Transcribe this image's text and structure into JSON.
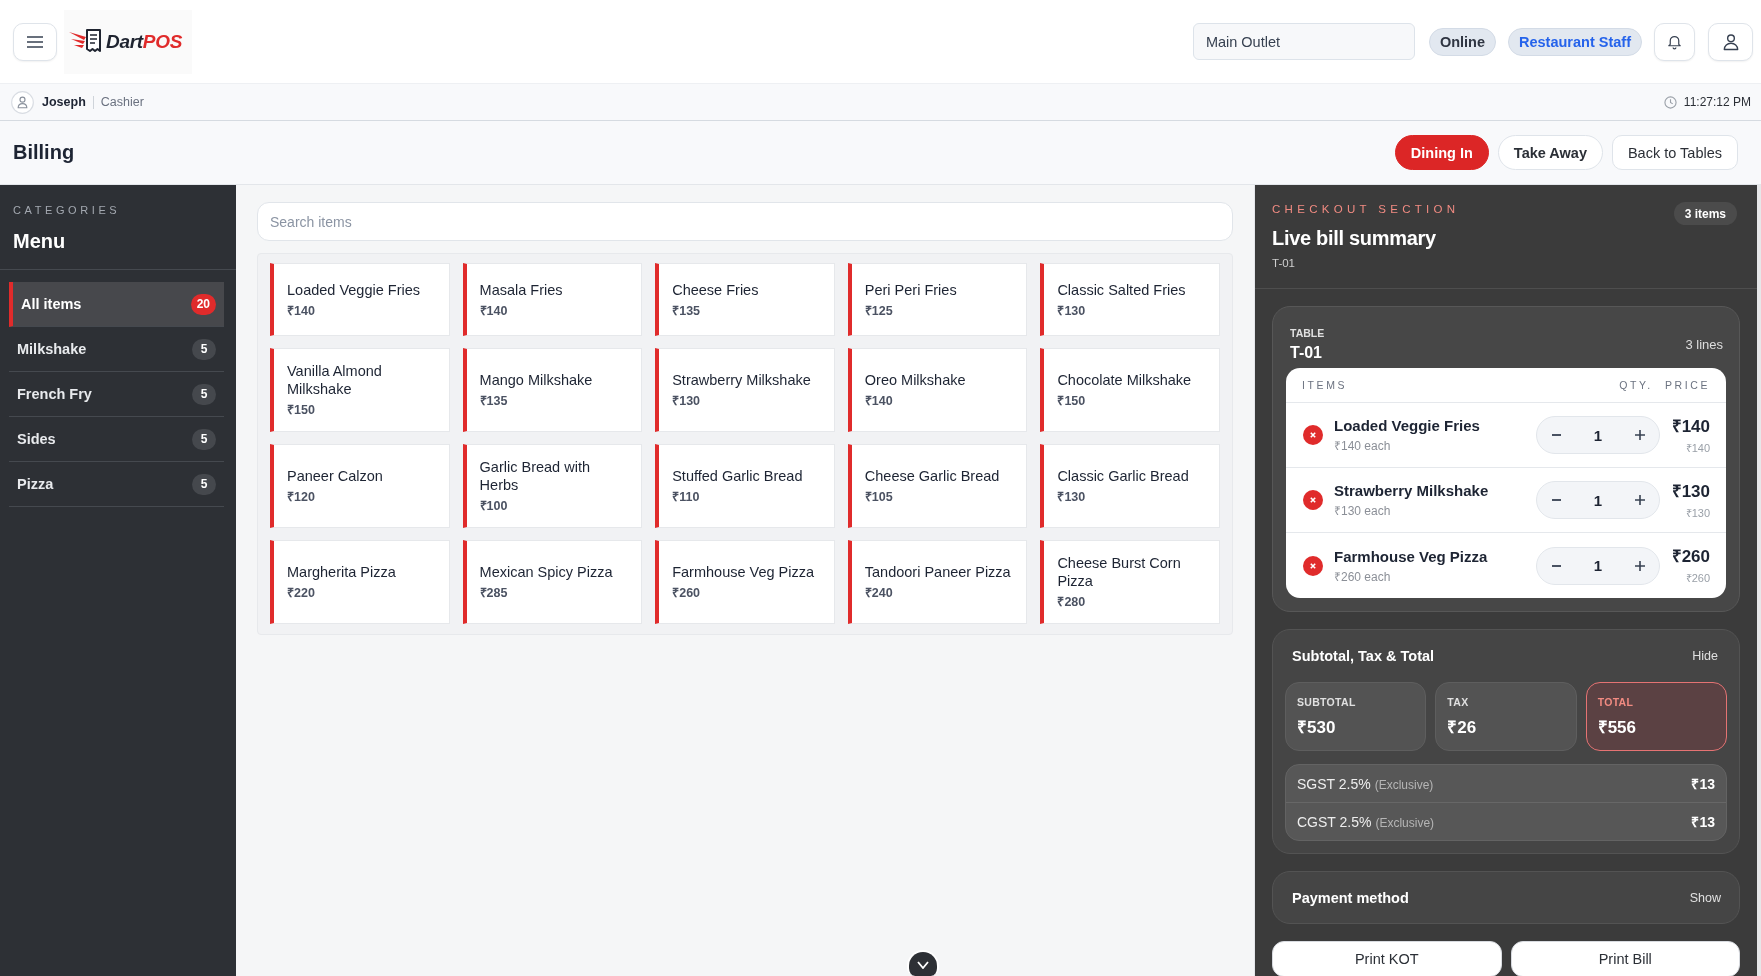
{
  "header": {
    "logo": {
      "brand": "Dart",
      "accent": "POS"
    },
    "outlet": {
      "value": "Main Outlet"
    },
    "status": "Online",
    "role": "Restaurant Staff"
  },
  "user_bar": {
    "name": "Joseph",
    "role": "Cashier",
    "time": "11:27:12 PM"
  },
  "page": {
    "title": "Billing",
    "order_types": [
      {
        "label": "Dining In",
        "selected": true
      },
      {
        "label": "Take Away",
        "selected": false
      }
    ],
    "back_button": "Back to Tables"
  },
  "sidebar": {
    "eyebrow": "CATEGORIES",
    "title": "Menu",
    "items": [
      {
        "label": "All items",
        "count": "20",
        "selected": true
      },
      {
        "label": "Milkshake",
        "count": "5",
        "selected": false
      },
      {
        "label": "French Fry",
        "count": "5",
        "selected": false
      },
      {
        "label": "Sides",
        "count": "5",
        "selected": false
      },
      {
        "label": "Pizza",
        "count": "5",
        "selected": false
      }
    ]
  },
  "search": {
    "placeholder": "Search items"
  },
  "products": [
    {
      "name": "Loaded Veggie Fries",
      "price": "₹140"
    },
    {
      "name": "Masala Fries",
      "price": "₹140"
    },
    {
      "name": "Cheese Fries",
      "price": "₹135"
    },
    {
      "name": "Peri Peri Fries",
      "price": "₹125"
    },
    {
      "name": "Classic Salted Fries",
      "price": "₹130"
    },
    {
      "name": "Vanilla Almond Milkshake",
      "price": "₹150"
    },
    {
      "name": "Mango Milkshake",
      "price": "₹135"
    },
    {
      "name": "Strawberry Milkshake",
      "price": "₹130"
    },
    {
      "name": "Oreo Milkshake",
      "price": "₹140"
    },
    {
      "name": "Chocolate Milkshake",
      "price": "₹150"
    },
    {
      "name": "Paneer Calzon",
      "price": "₹120"
    },
    {
      "name": "Garlic Bread with Herbs",
      "price": "₹100"
    },
    {
      "name": "Stuffed Garlic Bread",
      "price": "₹110"
    },
    {
      "name": "Cheese Garlic Bread",
      "price": "₹105"
    },
    {
      "name": "Classic Garlic Bread",
      "price": "₹130"
    },
    {
      "name": "Margherita Pizza",
      "price": "₹220"
    },
    {
      "name": "Mexican Spicy Pizza",
      "price": "₹285"
    },
    {
      "name": "Farmhouse Veg Pizza",
      "price": "₹260"
    },
    {
      "name": "Tandoori Paneer Pizza",
      "price": "₹240"
    },
    {
      "name": "Cheese Burst Corn Pizza",
      "price": "₹280"
    }
  ],
  "checkout": {
    "eyebrow": "CHECKOUT SECTION",
    "badge": "3 items",
    "title": "Live bill summary",
    "subtitle": "T-01",
    "table": {
      "label": "TABLE",
      "name": "T-01",
      "lines": "3 lines",
      "columns": [
        "ITEMS",
        "QTY.",
        "PRICE"
      ],
      "rows": [
        {
          "name": "Loaded Veggie Fries",
          "each": "₹140 each",
          "qty": "1",
          "total": "₹140",
          "unit": "₹140"
        },
        {
          "name": "Strawberry Milkshake",
          "each": "₹130 each",
          "qty": "1",
          "total": "₹130",
          "unit": "₹130"
        },
        {
          "name": "Farmhouse Veg Pizza",
          "each": "₹260 each",
          "qty": "1",
          "total": "₹260",
          "unit": "₹260"
        }
      ]
    },
    "totals": {
      "title": "Subtotal, Tax & Total",
      "toggle": "Hide",
      "cards": [
        {
          "label": "SUBTOTAL",
          "value": "₹530",
          "highlighted": false
        },
        {
          "label": "TAX",
          "value": "₹26",
          "highlighted": false
        },
        {
          "label": "TOTAL",
          "value": "₹556",
          "highlighted": true
        }
      ],
      "taxes": [
        {
          "label": "SGST 2.5%",
          "note": "(Exclusive)",
          "amount": "₹13"
        },
        {
          "label": "CGST 2.5%",
          "note": "(Exclusive)",
          "amount": "₹13"
        }
      ]
    },
    "payment": {
      "title": "Payment method",
      "toggle": "Show"
    },
    "actions": [
      "Print KOT",
      "Print Bill"
    ]
  }
}
